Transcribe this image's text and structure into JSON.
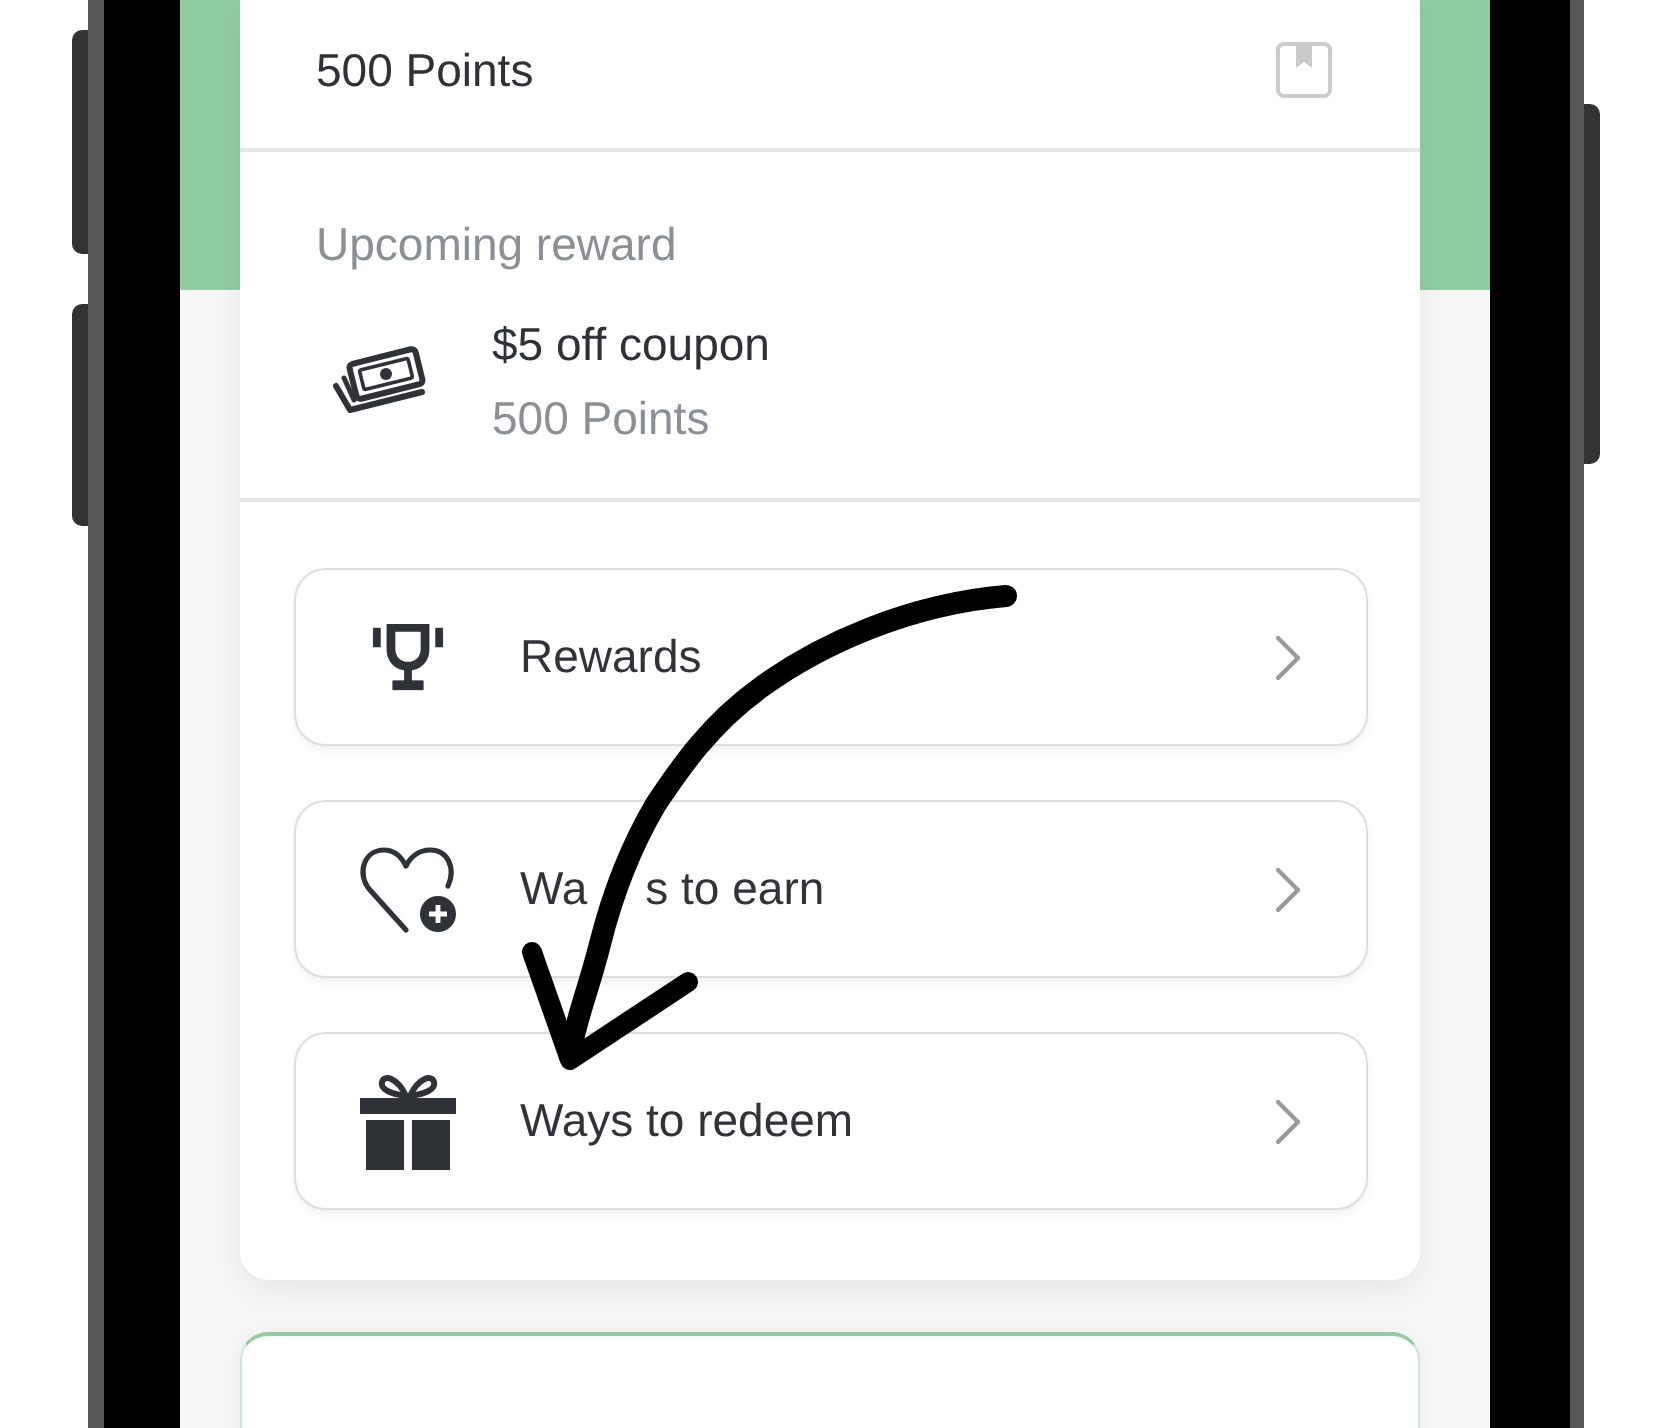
{
  "points_row": {
    "label": "500 Points"
  },
  "upcoming_reward": {
    "heading": "Upcoming reward",
    "title": "$5 off coupon",
    "points": "500 Points"
  },
  "menu_items": [
    {
      "label_parts": [
        "Rewards"
      ]
    },
    {
      "label_parts": [
        "Wa",
        "s to earn"
      ]
    },
    {
      "label_parts": [
        "Ways to redeem"
      ]
    }
  ]
}
